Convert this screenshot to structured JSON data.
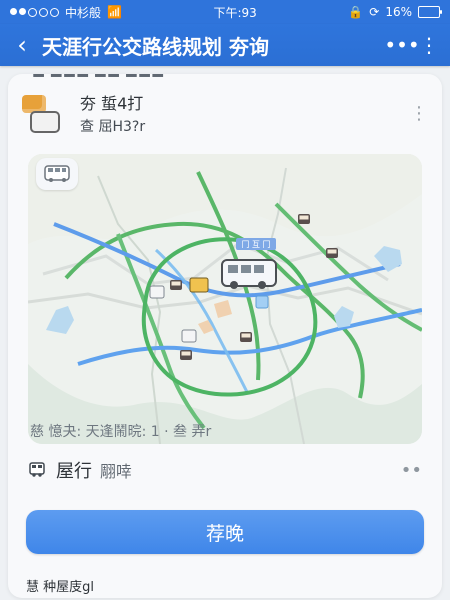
{
  "status": {
    "carrier": "中杉般",
    "time": "下午:93",
    "battery": "16%",
    "battery_level": 16
  },
  "nav": {
    "title": "天涯行公交路线规划 夯询"
  },
  "summary": {
    "line1": "夯 蜇4打",
    "line2": "查 屈H3?r"
  },
  "map": {
    "caption": "慈 憶夬: 天逢鬧晥: 1 · 叁 弄r",
    "station_label": "冂 互 冂"
  },
  "route": {
    "label": "屋行",
    "sub": "翢啈"
  },
  "button": {
    "label": "荐晚"
  },
  "footer": {
    "text": "慧 种屋庋gl"
  },
  "icons": {
    "back": "chevron-left-icon",
    "more": "more-dots-icon",
    "kebab": "kebab-icon",
    "bus": "bus-icon",
    "wifi": "wifi-icon",
    "lock": "lock-icon",
    "battery": "battery-icon"
  },
  "colors": {
    "brand_blue": "#2f74db",
    "button_blue": "#4a8eef",
    "route_green": "#58b96c",
    "route_blue": "#5a95e6"
  }
}
